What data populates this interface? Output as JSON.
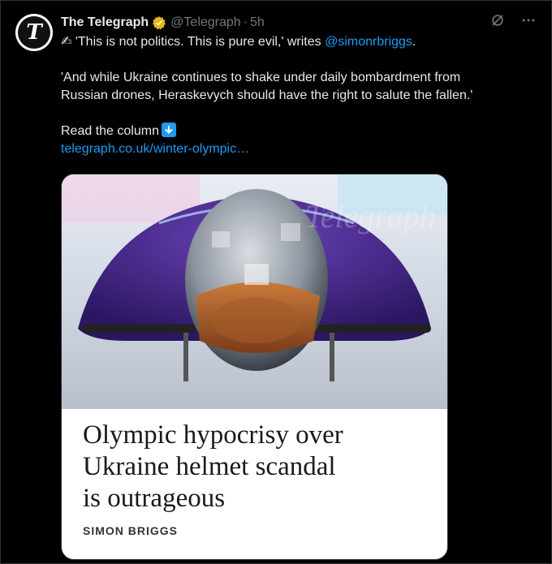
{
  "tweet": {
    "author_name": "The Telegraph",
    "handle": "@Telegraph",
    "separator": "·",
    "time": "5h",
    "avatar_letter": "T",
    "line1_prefix": "✍ 'This is not politics. This is pure evil,' writes ",
    "line1_mention": "@simonrbriggs",
    "line1_suffix": ".",
    "para2_line1": "'And while Ukraine continues to shake under daily bombardment from",
    "para2_line2": "Russian drones, Heraskevych should have the right to salute the fallen.'",
    "cta": "Read the column",
    "link": "telegraph.co.uk/winter-olympic…"
  },
  "card": {
    "headline_line1": "Olympic hypocrisy over",
    "headline_line2": "Ukraine helmet scandal",
    "headline_line3": "is outrageous",
    "byline": "SIMON BRIGGS",
    "watermark": "Telegraph"
  },
  "colors": {
    "background": "#000000",
    "text": "#e7e9ea",
    "muted": "#71767b",
    "link": "#1d9bf0",
    "verified_gold": "#e2b719"
  },
  "icons": [
    "grok-icon",
    "more-icon",
    "verified-badge-icon",
    "down-arrow-icon"
  ]
}
